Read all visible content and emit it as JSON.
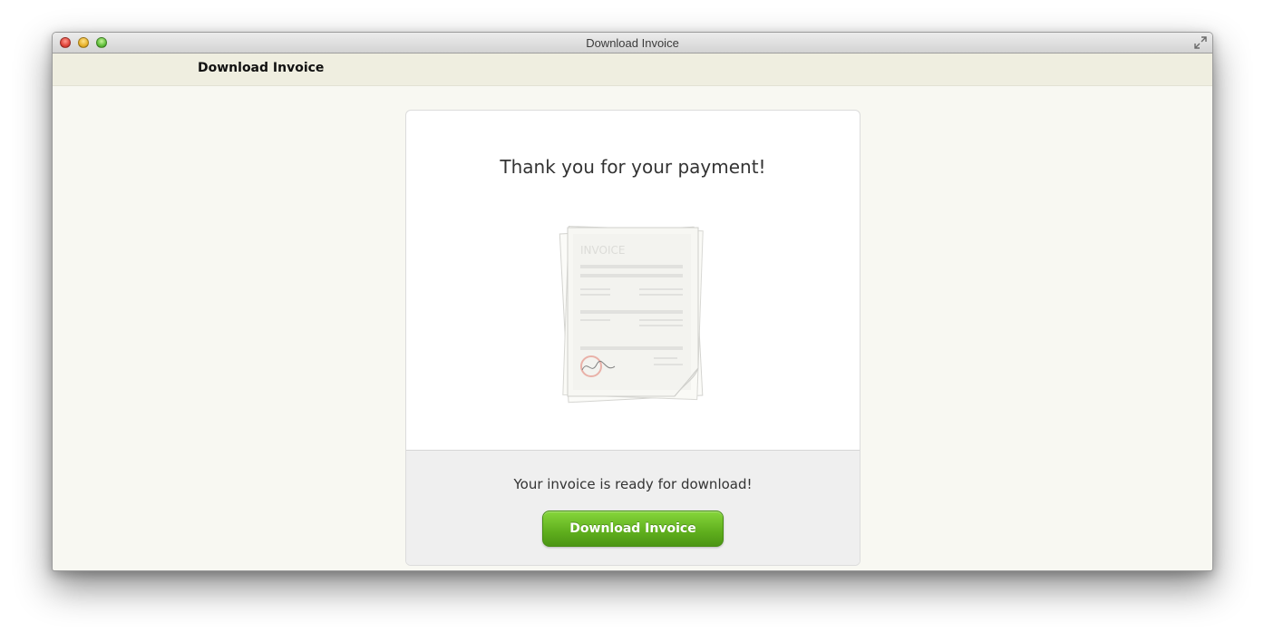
{
  "window": {
    "title": "Download Invoice"
  },
  "toolbar": {
    "title": "Download Invoice"
  },
  "card": {
    "heading": "Thank you for your payment!",
    "illustration": {
      "icon": "invoice-document-icon",
      "label": "INVOICE"
    },
    "ready_text": "Your invoice is ready for download!",
    "download_label": "Download Invoice"
  },
  "colors": {
    "button_green": "#6cc22a",
    "window_bg": "#f8f8f2",
    "toolbar_bg": "#efeee0"
  }
}
